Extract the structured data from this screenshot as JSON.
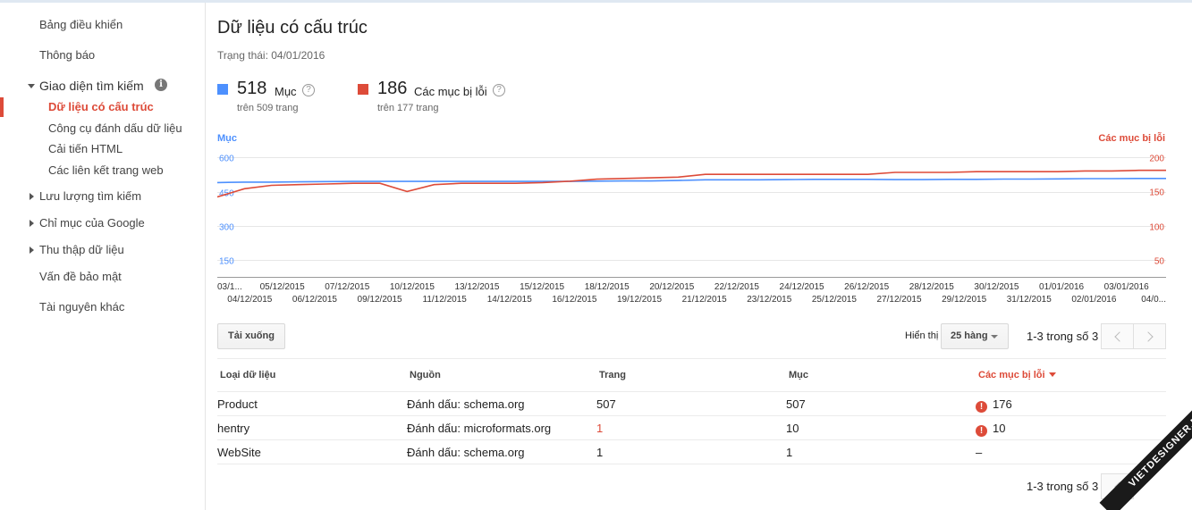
{
  "sidebar": {
    "dashboard": "Bảng điều khiển",
    "messages": "Thông báo",
    "search_appearance": "Giao diện tìm kiếm",
    "structured_data": "Dữ liệu có cấu trúc",
    "data_highlighter": "Công cụ đánh dấu dữ liệu",
    "html_improvements": "Cải tiến HTML",
    "sitelinks": "Các liên kết trang web",
    "search_traffic": "Lưu lượng tìm kiếm",
    "google_index": "Chỉ mục của Google",
    "crawl": "Thu thập dữ liệu",
    "security_issues": "Vấn đề bảo mật",
    "other_resources": "Tài nguyên khác"
  },
  "page": {
    "title": "Dữ liệu có cấu trúc",
    "status": "Trạng thái: 04/01/2016"
  },
  "metrics": {
    "items_count": "518",
    "items_label": "Mục",
    "items_sub": "trên 509 trang",
    "errors_count": "186",
    "errors_label": "Các mục bị lỗi",
    "errors_sub": "trên 177 trang"
  },
  "colors": {
    "items": "#4d90fe",
    "errors": "#dd4b39"
  },
  "chart_data": {
    "type": "line",
    "ylabel": "Mục",
    "y2label": "Các mục bị lỗi",
    "ylim": [
      75,
      625
    ],
    "y2lim": [
      25,
      208
    ],
    "left_ticks": [
      "600",
      "450",
      "300",
      "150"
    ],
    "right_ticks": [
      "200",
      "150",
      "100",
      "50"
    ],
    "x_top": [
      "03/1...",
      "05/12/2015",
      "07/12/2015",
      "10/12/2015",
      "13/12/2015",
      "15/12/2015",
      "18/12/2015",
      "20/12/2015",
      "22/12/2015",
      "24/12/2015",
      "26/12/2015",
      "28/12/2015",
      "30/12/2015",
      "01/01/2016",
      "03/01/2016"
    ],
    "x_bottom": [
      "04/12/2015",
      "06/12/2015",
      "09/12/2015",
      "11/12/2015",
      "14/12/2015",
      "16/12/2015",
      "19/12/2015",
      "21/12/2015",
      "23/12/2015",
      "25/12/2015",
      "27/12/2015",
      "29/12/2015",
      "31/12/2015",
      "02/01/2016",
      "04/0..."
    ],
    "series": [
      {
        "name": "Mục",
        "axis": "left",
        "values": [
          490,
          492,
          492,
          493,
          494,
          495,
          495,
          495,
          495,
          495,
          495,
          495,
          495,
          495,
          496,
          497,
          497,
          499,
          502,
          502,
          502,
          503,
          504,
          504,
          504,
          503,
          503,
          504,
          504,
          505,
          505,
          506,
          507,
          507,
          508,
          508
        ]
      },
      {
        "name": "Các mục bị lỗi",
        "axis": "right",
        "values": [
          142,
          154,
          159,
          160,
          161,
          162,
          162,
          150,
          160,
          162,
          162,
          162,
          163,
          165,
          168,
          169,
          170,
          171,
          175,
          175,
          175,
          175,
          175,
          175,
          175,
          178,
          178,
          178,
          179,
          179,
          179,
          179,
          180,
          180,
          181,
          181
        ]
      }
    ]
  },
  "controls": {
    "download": "Tải xuống",
    "show_label": "Hiển thị",
    "rows_value": "25 hàng",
    "pager_text": "1-3 trong số 3"
  },
  "table": {
    "headers": {
      "type": "Loại dữ liệu",
      "source": "Nguồn",
      "pages": "Trang",
      "items": "Mục",
      "errors": "Các mục bị lỗi"
    },
    "rows": [
      {
        "type": "Product",
        "source": "Đánh dấu: schema.org",
        "pages": "507",
        "items": "507",
        "errors": "176"
      },
      {
        "type": "hentry",
        "source": "Đánh dấu: microformats.org",
        "pages": "1",
        "items": "10",
        "errors": "10"
      },
      {
        "type": "WebSite",
        "source": "Đánh dấu: schema.org",
        "pages": "1",
        "items": "1",
        "errors": "–"
      }
    ]
  },
  "watermark": "VIETDESIGNER.NET"
}
